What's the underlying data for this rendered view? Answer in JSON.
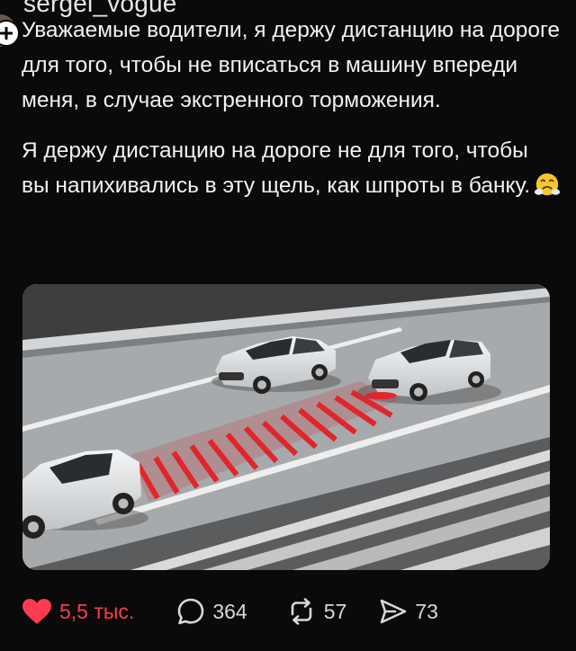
{
  "author": {
    "name_cut": "sergei_vogue"
  },
  "post": {
    "paragraphs": [
      "Уважаемые водители, я держу дистанцию на дороге для того, чтобы не вписаться в машину впереди меня, в случае экстренного торможения.",
      "Я держу дистанцию на дороге не для того, чтобы вы напихивались в эту щель, как шпроты в банку."
    ],
    "emoji": "face-with-steam-from-nose"
  },
  "actions": {
    "likes": "5,5 тыс.",
    "replies": "364",
    "reposts": "57",
    "shares": "73"
  },
  "colors": {
    "like_red": "#ff3b4f",
    "background": "#0a0a0a",
    "text": "#f2f2f2",
    "meta": "#d8d8d8",
    "road_marking": "#e0262c"
  }
}
